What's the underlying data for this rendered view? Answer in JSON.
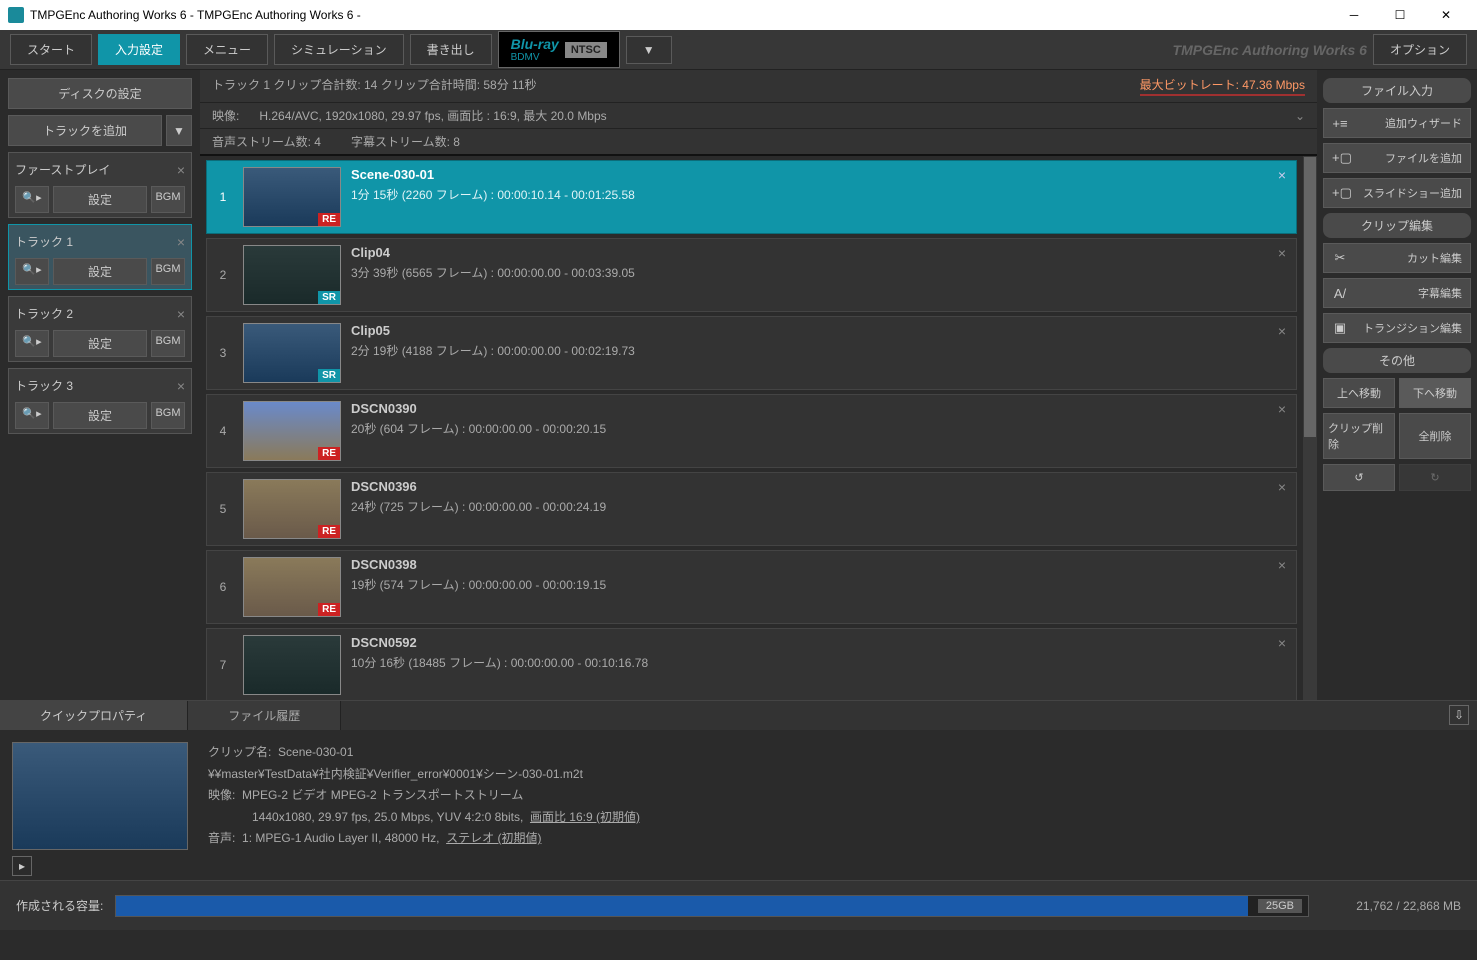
{
  "window": {
    "title": "TMPGEnc Authoring Works 6 - TMPGEnc Authoring Works 6 -"
  },
  "toolbar": {
    "start": "スタート",
    "input": "入力設定",
    "menu": "メニュー",
    "simulation": "シミュレーション",
    "export": "書き出し",
    "format_main": "Blu-ray",
    "format_sub": "BDMV",
    "format_std": "NTSC",
    "dropdown": "▼",
    "brand": "TMPGEnc Authoring Works 6",
    "option": "オプション"
  },
  "left": {
    "disc_settings": "ディスクの設定",
    "add_track": "トラックを追加",
    "caret": "▼",
    "firstplay": "ファーストプレイ",
    "search": "🔍▸",
    "settings": "設定",
    "bgm": "BGM",
    "tracks": [
      {
        "name": "トラック 1"
      },
      {
        "name": "トラック 2"
      },
      {
        "name": "トラック 3"
      }
    ]
  },
  "info": {
    "line1_left": "トラック 1   クリップ合計数:  14     クリップ合計時間:   58分 11秒",
    "rate": "最大ビットレート: 47.36 Mbps",
    "video_label": "映像:",
    "video_val": "H.264/AVC,  1920x1080,  29.97 fps,   画面比 : 16:9, 最大 20.0 Mbps",
    "audio_label": "音声ストリーム数: 4",
    "sub_label": "字幕ストリーム数:  8"
  },
  "clips": [
    {
      "n": "1",
      "title": "Scene-030-01",
      "sub": "1分 15秒 (2260 フレーム) :  00:00:10.14 - 00:01:25.58",
      "badge": "RE",
      "sel": true,
      "th": ""
    },
    {
      "n": "2",
      "title": "Clip04",
      "sub": "3分 39秒 (6565 フレーム) :  00:00:00.00 - 00:03:39.05",
      "badge": "SR",
      "th": "dark"
    },
    {
      "n": "3",
      "title": "Clip05",
      "sub": "2分 19秒 (4188 フレーム) :  00:00:00.00 - 00:02:19.73",
      "badge": "SR",
      "th": ""
    },
    {
      "n": "4",
      "title": "DSCN0390",
      "sub": "20秒 (604 フレーム) :  00:00:00.00 - 00:00:20.15",
      "badge": "RE",
      "th": "sky"
    },
    {
      "n": "5",
      "title": "DSCN0396",
      "sub": "24秒 (725 フレーム) :  00:00:00.00 - 00:00:24.19",
      "badge": "RE",
      "th": "rock"
    },
    {
      "n": "6",
      "title": "DSCN0398",
      "sub": "19秒 (574 フレーム) :  00:00:00.00 - 00:00:19.15",
      "badge": "RE",
      "th": "rock"
    },
    {
      "n": "7",
      "title": "DSCN0592",
      "sub": "10分 16秒 (18485 フレーム) :  00:00:00.00 - 00:10:16.78",
      "badge": "",
      "th": "dark"
    }
  ],
  "right": {
    "file_input": "ファイル入力",
    "add_wizard": "追加ウィザード",
    "add_file": "ファイルを追加",
    "add_slideshow": "スライドショー追加",
    "clip_edit": "クリップ編集",
    "cut_edit": "カット編集",
    "sub_edit": "字幕編集",
    "trans_edit": "トランジション編集",
    "other": "その他",
    "move_up": "上へ移動",
    "move_down": "下へ移動",
    "clip_delete": "クリップ削除",
    "all_delete": "全削除",
    "undo": "↺",
    "redo": "↻"
  },
  "tabs": {
    "quick": "クイックプロパティ",
    "history": "ファイル履歴"
  },
  "props": {
    "clip_name_label": "クリップ名:",
    "clip_name": "Scene-030-01",
    "path": "¥¥master¥TestData¥社内検証¥Verifier_error¥0001¥シーン-030-01.m2t",
    "video_label": "映像:",
    "video": "MPEG-2 ビデオ  MPEG-2 トランスポートストリーム",
    "video2": "1440x1080,  29.97 fps,  25.0 Mbps,  YUV 4:2:0 8bits,",
    "video2_u": "画面比 16:9 (初期値)",
    "audio_label": "音声:",
    "audio": "1:  MPEG-1 Audio Layer II, 48000 Hz,",
    "audio_u": "ステレオ (初期値)"
  },
  "footer": {
    "label": "作成される容量:",
    "size": "25GB",
    "stat": "21,762 / 22,868 MB"
  }
}
